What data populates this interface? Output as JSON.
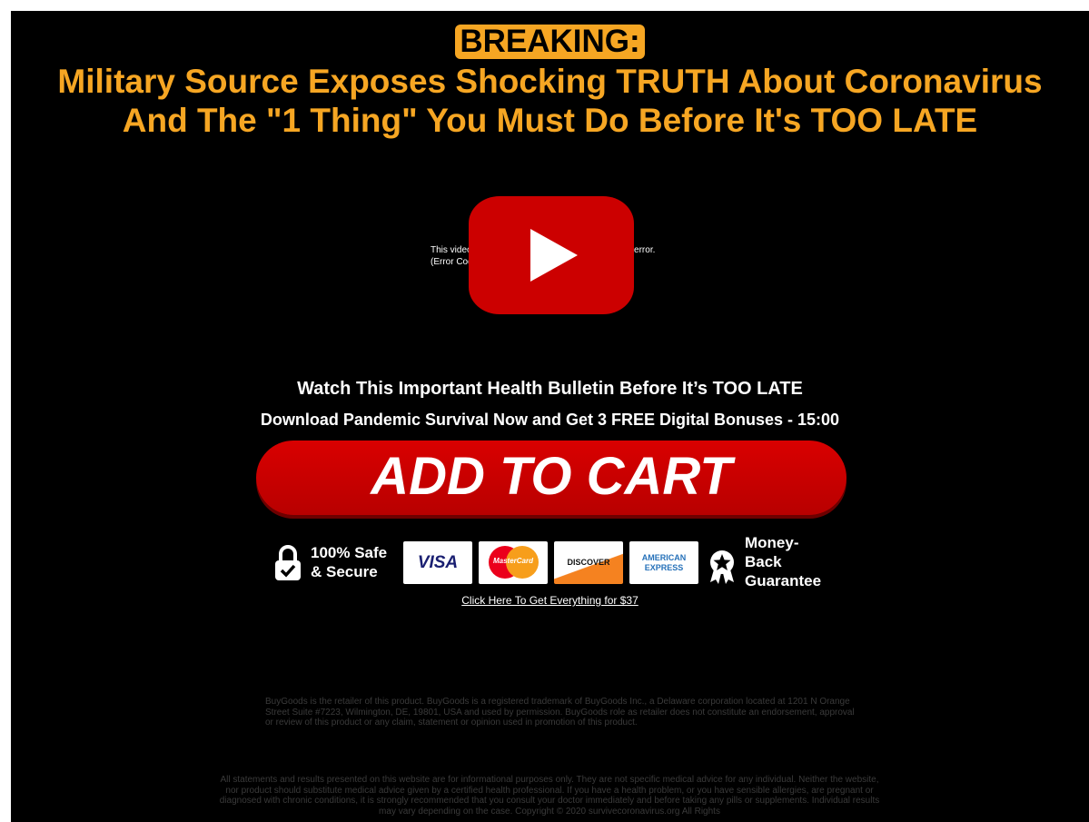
{
  "header": {
    "breaking_label": "BREAKING:",
    "headline_line1": "Military Source Exposes Shocking TRUTH About Coronavirus",
    "headline_line2": "And The \"1 Thing\" You Must Do Before It's TOO LATE"
  },
  "video": {
    "error_line1": "This video file cannot be played due to a technical error.",
    "error_line2": "(Error Code: 224003)",
    "play_icon": "play-icon"
  },
  "offer": {
    "bulletin": "Watch This Important Health Bulletin Before It’s TOO LATE",
    "download_text": "Download Pandemic Survival Now and Get 3 FREE Digital Bonuses - 15:00",
    "add_to_cart_label": "ADD TO CART"
  },
  "trust": {
    "safe_line1": "100% Safe",
    "safe_line2": "& Secure",
    "cards": {
      "visa": "VISA",
      "mastercard": "MasterCard",
      "discover": "DISCOVER",
      "amex_line1": "AMERICAN",
      "amex_line2": "EXPRESS"
    },
    "guarantee_text": "Money-\nBack\nGuarantee",
    "colors": {
      "accent": "#f6a623",
      "cart_red": "#cc0000"
    }
  },
  "links": {
    "everything": "Click Here To Get Everything for $37"
  },
  "footer": {
    "buygoods_disclaimer": "BuyGoods is the retailer of this product. BuyGoods is a registered trademark of BuyGoods Inc., a Delaware corporation located at 1201 N Orange Street Suite #7223, Wilmington, DE, 19801, USA and used by permission. BuyGoods role as retailer does not constitute an endorsement, approval or review of this product or any claim, statement or opinion used in promotion of this product.",
    "medical_disclaimer": "All statements and results presented on this website are for informational purposes only. They are not specific medical advice for any individual. Neither the website, nor product should substitute medical advice given by a certified health professional. If you have a health problem, or you have sensible allergies, are pregnant or diagnosed with chronic conditions, it is strongly recommended that you consult your doctor immediately and before taking any pills or supplements. Individual results may vary depending on the case. Copyright © 2020 survivecoronavirus.org All Rights"
  }
}
